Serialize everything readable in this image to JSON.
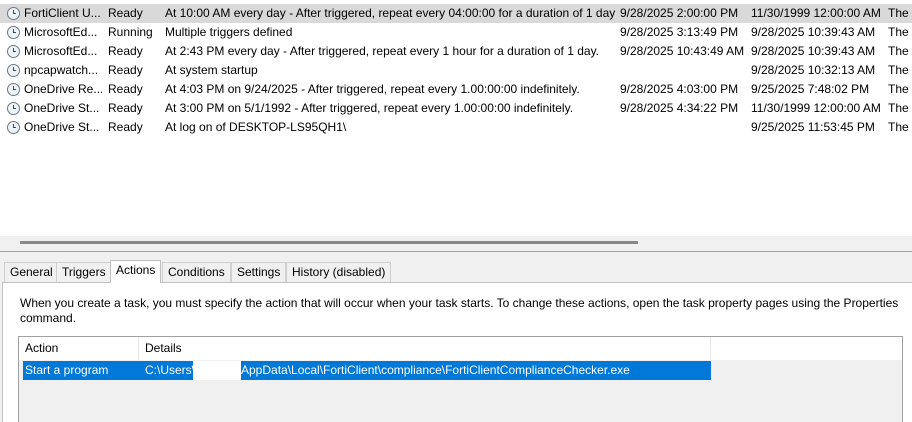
{
  "tasks": [
    {
      "name": "FortiClient U...",
      "status": "Ready",
      "triggers": "At 10:00 AM every day - After triggered, repeat every 04:00:00 for a duration of 1 day.",
      "next_run": "9/28/2025 2:00:00 PM",
      "last_run": "11/30/1999 12:00:00 AM",
      "result": "The t"
    },
    {
      "name": "MicrosoftEd...",
      "status": "Running",
      "triggers": "Multiple triggers defined",
      "next_run": "9/28/2025 3:13:49 PM",
      "last_run": "9/28/2025 10:39:43 AM",
      "result": "The"
    },
    {
      "name": "MicrosoftEd...",
      "status": "Ready",
      "triggers": "At 2:43 PM every day - After triggered, repeat every 1 hour for a duration of 1 day.",
      "next_run": "9/28/2025 10:43:49 AM",
      "last_run": "9/28/2025 10:39:43 AM",
      "result": "The"
    },
    {
      "name": "npcapwatch...",
      "status": "Ready",
      "triggers": "At system startup",
      "next_run": "",
      "last_run": "9/28/2025 10:32:13 AM",
      "result": "The c"
    },
    {
      "name": "OneDrive Re...",
      "status": "Ready",
      "triggers": "At 4:03 PM on 9/24/2025 - After triggered, repeat every 1.00:00:00 indefinitely.",
      "next_run": "9/28/2025 4:03:00 PM",
      "last_run": "9/25/2025 7:48:02 PM",
      "result": "The"
    },
    {
      "name": "OneDrive St...",
      "status": "Ready",
      "triggers": "At 3:00 PM on 5/1/1992 - After triggered, repeat every 1.00:00:00 indefinitely.",
      "next_run": "9/28/2025 4:34:22 PM",
      "last_run": "11/30/1999 12:00:00 AM",
      "result": "The t"
    },
    {
      "name": "OneDrive St...",
      "status": "Ready",
      "triggers": "At log on of DESKTOP-LS95QH1\\",
      "next_run": "",
      "last_run": "9/25/2025 11:53:45 PM",
      "result": "The"
    }
  ],
  "tabs": [
    "General",
    "Triggers",
    "Actions",
    "Conditions",
    "Settings",
    "History (disabled)"
  ],
  "active_tab": "Actions",
  "actions_panel": {
    "description": "When you create a task, you must specify the action that will occur when your task starts.  To change these actions, open the task property pages using the Properties command.",
    "columns": {
      "action": "Action",
      "details": "Details"
    },
    "rows": [
      {
        "action": "Start a program",
        "details_prefix": "C:\\Users\\",
        "details_suffix": "AppData\\Local\\FortiClient\\compliance\\FortiClientComplianceChecker.exe"
      }
    ]
  },
  "colors": {
    "selection": "#0078d7",
    "row_highlight": "#d9d9d9"
  }
}
